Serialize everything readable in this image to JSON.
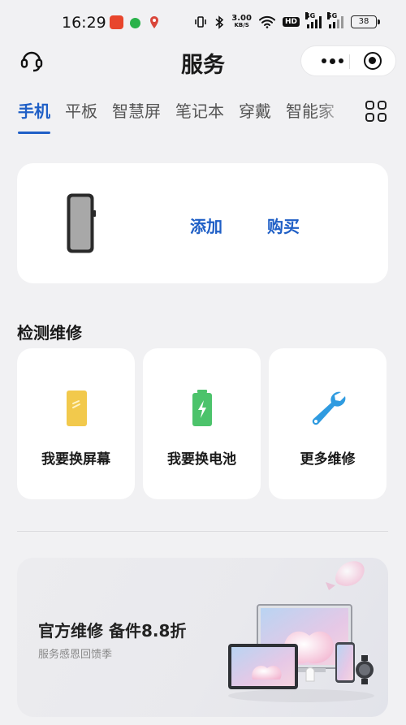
{
  "status_bar": {
    "time": "16:29",
    "net_speed_value": "3.00",
    "net_speed_unit": "KB/S",
    "hd_label": "HD",
    "sim1_label": "4G",
    "sim2_label": "5G",
    "battery": "38"
  },
  "header": {
    "title": "服务"
  },
  "tabs": {
    "items": [
      "手机",
      "平板",
      "智慧屏",
      "笔记本",
      "穿戴",
      "智能家"
    ],
    "active_index": 0
  },
  "device_card": {
    "add_label": "添加",
    "buy_label": "购买"
  },
  "repair": {
    "section_title": "检测维修",
    "items": [
      {
        "label": "我要换屏幕",
        "icon": "screen-icon"
      },
      {
        "label": "我要换电池",
        "icon": "battery-icon"
      },
      {
        "label": "更多维修",
        "icon": "wrench-icon"
      }
    ]
  },
  "banner": {
    "title": "官方维修 备件8.8折",
    "subtitle": "服务感恩回馈季"
  },
  "colors": {
    "accent": "#1f5fc6",
    "background": "#f1f1f3",
    "card": "#ffffff",
    "screen_icon": "#f2c94c",
    "battery_icon": "#4cc36b",
    "wrench_icon": "#2f9be0"
  }
}
